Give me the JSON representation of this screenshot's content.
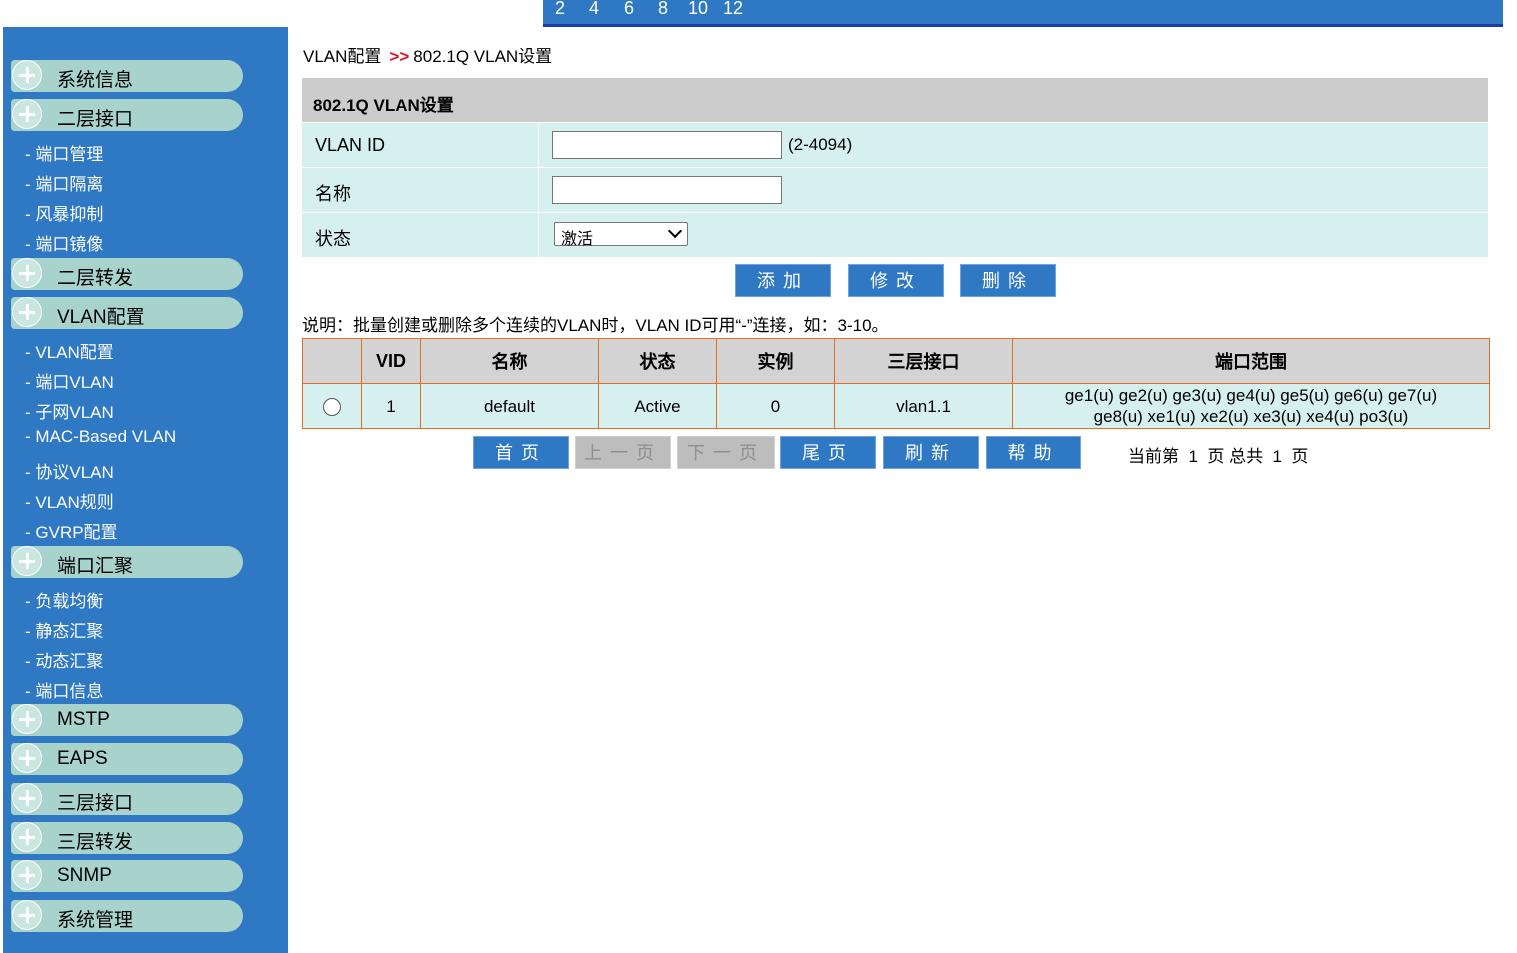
{
  "topbar": {
    "numbers": [
      "2",
      "4",
      "6",
      "8",
      "10",
      "12"
    ]
  },
  "sidebar": {
    "groups": [
      {
        "label": "系统信息"
      },
      {
        "label": "二层接口"
      },
      {
        "label": "二层转发"
      },
      {
        "label": "VLAN配置"
      },
      {
        "label": "端口汇聚"
      },
      {
        "label": "MSTP"
      },
      {
        "label": "EAPS"
      },
      {
        "label": "三层接口"
      },
      {
        "label": "三层转发"
      },
      {
        "label": "SNMP"
      },
      {
        "label": "系统管理"
      }
    ],
    "layer2_items": [
      "- 端口管理",
      "- 端口隔离",
      "- 风暴抑制",
      "- 端口镜像"
    ],
    "vlan_items": [
      "- VLAN配置",
      "- 端口VLAN",
      "- 子网VLAN",
      "- MAC-Based VLAN",
      "- 协议VLAN",
      "- VLAN规则",
      "- GVRP配置"
    ],
    "agg_items": [
      "- 负载均衡",
      "- 静态汇聚",
      "- 动态汇聚",
      "- 端口信息"
    ]
  },
  "breadcrumb": {
    "parent": "VLAN配置",
    "separator": ">>",
    "current": "802.1Q VLAN设置"
  },
  "form": {
    "title": "802.1Q VLAN设置",
    "vlan_id_label": "VLAN ID",
    "vlan_id_value": "",
    "vlan_id_hint": "(2-4094)",
    "name_label": "名称",
    "name_value": "",
    "status_label": "状态",
    "status_value": "激活"
  },
  "actions": {
    "add": "添加",
    "modify": "修改",
    "delete": "删除"
  },
  "note": "说明：批量创建或删除多个连续的VLAN时，VLAN ID可用“-”连接，如：3-10。",
  "table": {
    "headers": [
      "",
      "VID",
      "名称",
      "状态",
      "实例",
      "三层接口",
      "端口范围"
    ],
    "rows": [
      {
        "vid": "1",
        "name": "default",
        "status": "Active",
        "instance": "0",
        "l3if": "vlan1.1",
        "ports_line1": "ge1(u) ge2(u) ge3(u) ge4(u) ge5(u) ge6(u) ge7(u)",
        "ports_line2": "ge8(u) xe1(u) xe2(u) xe3(u) xe4(u) po3(u)"
      }
    ]
  },
  "pager": {
    "first": "首页",
    "prev": "上一页",
    "next": "下一页",
    "last": "尾页",
    "refresh": "刷新",
    "help": "帮助",
    "info": "当前第  1  页 总共  1  页"
  },
  "colors": {
    "accent": "#2e78c4",
    "sidebar_group": "#a8d3cc",
    "row_bg": "#d6efef",
    "table_border": "#e06d21",
    "breadcrumb_sep": "#e0151b"
  }
}
